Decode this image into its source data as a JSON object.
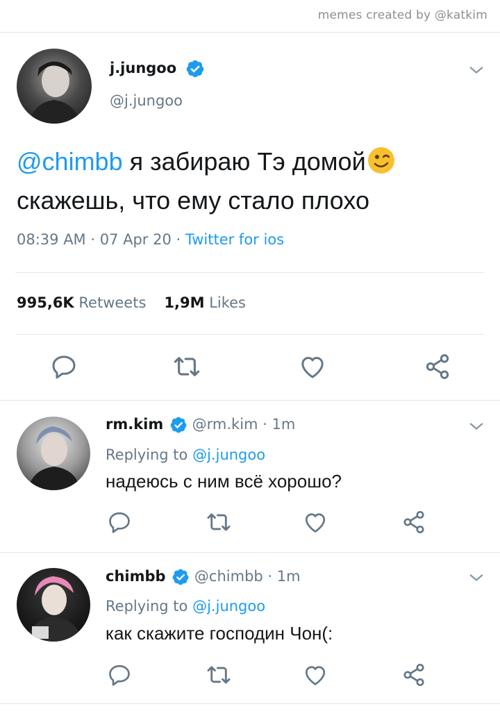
{
  "credit": "memes created by @katkim",
  "main_tweet": {
    "display_name": "j.jungoo",
    "handle": "@j.jungoo",
    "mention": "@chimbb",
    "text_line1": "я забираю Тэ домой",
    "text_line2": "скажешь, что ему стало плохо",
    "emoji": "winking-face",
    "time": "08:39 AM",
    "sep1": " · ",
    "date": "07 Apr 20",
    "sep2": " · ",
    "source": "Twitter for ios",
    "retweets_count": "995,6K",
    "retweets_label": "Retweets",
    "likes_count": "1,9M",
    "likes_label": "Likes"
  },
  "replies": [
    {
      "display_name": "rm.kim",
      "handle": "@rm.kim",
      "sep": " · ",
      "age": "1m",
      "replying_label": "Replying to",
      "replying_to": "@j.jungoo",
      "text": "надеюсь с ним всё хорошо?"
    },
    {
      "display_name": "chimbb",
      "handle": "@chimbb",
      "sep": " · ",
      "age": "1m",
      "replying_label": "Replying to",
      "replying_to": "@j.jungoo",
      "text": "как скажите господин Чон(:"
    }
  ],
  "colors": {
    "accent": "#1d9bf0",
    "muted": "#657786",
    "text": "#14171a",
    "divider": "#e3e6e8",
    "icon": "#657786"
  },
  "icons": [
    "chevron-down-icon",
    "verified-badge-icon",
    "reply-icon",
    "retweet-icon",
    "like-icon",
    "share-icon"
  ]
}
